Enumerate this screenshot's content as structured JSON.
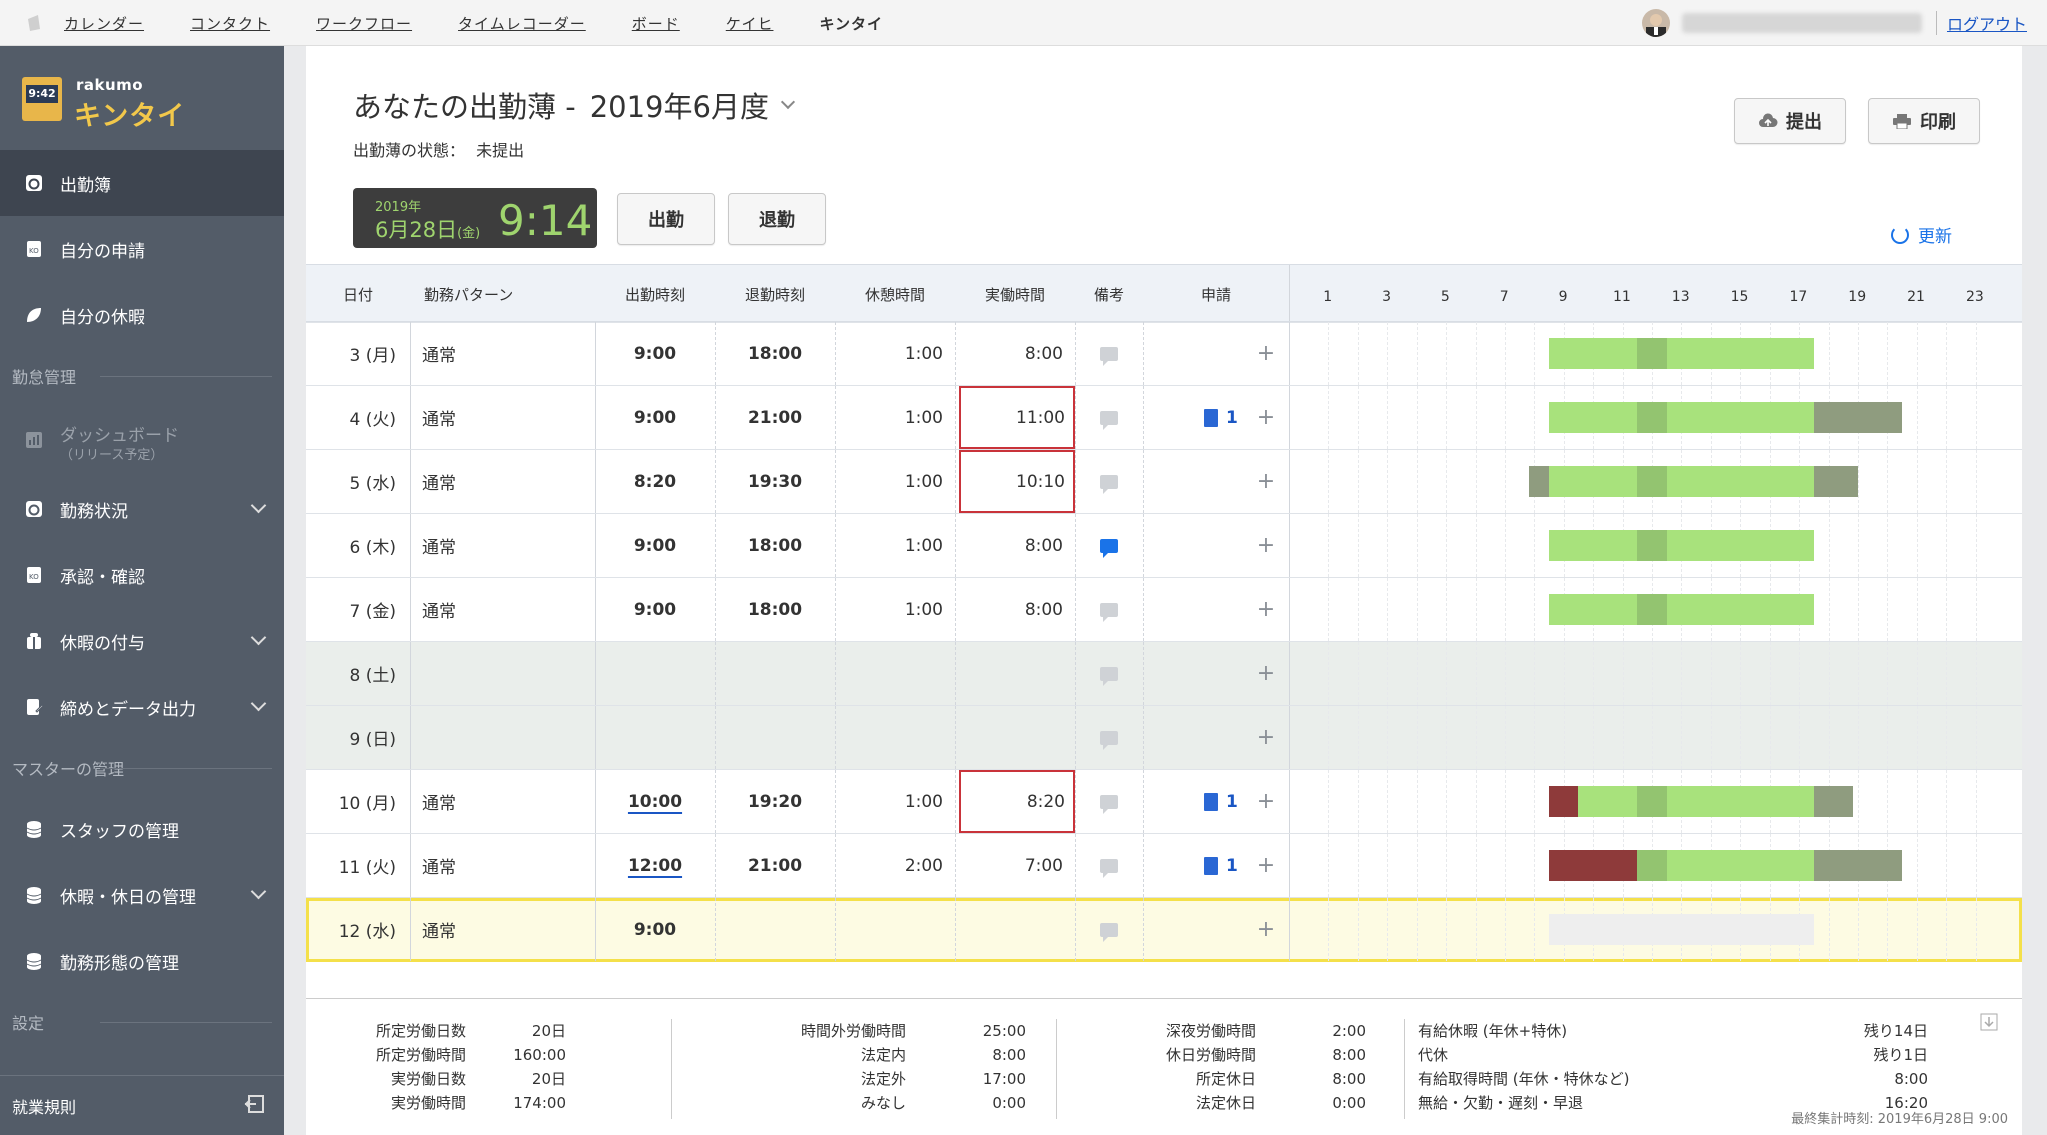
{
  "topnav": {
    "items": [
      "カレンダー",
      "コンタクト",
      "ワークフロー",
      "タイムレコーダー",
      "ボード",
      "ケイヒ",
      "キンタイ"
    ],
    "logout": "ログアウト"
  },
  "brand": {
    "name": "rakumo",
    "product": "キンタイ",
    "clock_face": "9:42"
  },
  "sidebar": {
    "items": [
      {
        "label": "出勤簿"
      },
      {
        "label": "自分の申請"
      },
      {
        "label": "自分の休暇"
      }
    ],
    "section1": "勤怠管理",
    "mgmt": [
      {
        "label": "ダッシュボード",
        "sub": "（リリース予定）"
      },
      {
        "label": "勤務状況"
      },
      {
        "label": "承認・確認"
      },
      {
        "label": "休暇の付与"
      },
      {
        "label": "締めとデータ出力"
      }
    ],
    "section2": "マスターの管理",
    "master": [
      {
        "label": "スタッフの管理"
      },
      {
        "label": "休暇・休日の管理"
      },
      {
        "label": "勤務形態の管理"
      }
    ],
    "section3": "設定",
    "bottom": "就業規則"
  },
  "header": {
    "title": "あなたの出勤薄 -",
    "period": "2019年6月度",
    "status_label": "出勤薄の状態：",
    "status_value": "未提出",
    "submit": "提出",
    "print": "印刷",
    "refresh": "更新"
  },
  "clock": {
    "year": "2019年",
    "date": "6月28日",
    "dow": "(金)",
    "time": "9:14"
  },
  "actions": {
    "clock_in": "出勤",
    "clock_out": "退勤"
  },
  "columns": [
    "日付",
    "勤務パターン",
    "出勤時刻",
    "退勤時刻",
    "休憩時間",
    "実働時間",
    "備考",
    "申請"
  ],
  "hours": [
    "1",
    "3",
    "5",
    "7",
    "9",
    "11",
    "13",
    "15",
    "17",
    "19",
    "21",
    "23"
  ],
  "rows": [
    {
      "date": "3 (月)",
      "pattern": "通常",
      "in": "9:00",
      "out": "18:00",
      "break": "1:00",
      "work": "8:00",
      "req": ""
    },
    {
      "date": "4 (火)",
      "pattern": "通常",
      "in": "9:00",
      "out": "21:00",
      "break": "1:00",
      "work": "11:00",
      "req": "1"
    },
    {
      "date": "5 (水)",
      "pattern": "通常",
      "in": "8:20",
      "out": "19:30",
      "break": "1:00",
      "work": "10:10",
      "req": ""
    },
    {
      "date": "6 (木)",
      "pattern": "通常",
      "in": "9:00",
      "out": "18:00",
      "break": "1:00",
      "work": "8:00",
      "req": ""
    },
    {
      "date": "7 (金)",
      "pattern": "通常",
      "in": "9:00",
      "out": "18:00",
      "break": "1:00",
      "work": "8:00",
      "req": ""
    },
    {
      "date": "8 (土)",
      "pattern": "",
      "in": "",
      "out": "",
      "break": "",
      "work": "",
      "req": ""
    },
    {
      "date": "9 (日)",
      "pattern": "",
      "in": "",
      "out": "",
      "break": "",
      "work": "",
      "req": ""
    },
    {
      "date": "10 (月)",
      "pattern": "通常",
      "in": "10:00",
      "out": "19:20",
      "break": "1:00",
      "work": "8:20",
      "req": "1"
    },
    {
      "date": "11 (火)",
      "pattern": "通常",
      "in": "12:00",
      "out": "21:00",
      "break": "2:00",
      "work": "7:00",
      "req": "1"
    },
    {
      "date": "12 (水)",
      "pattern": "通常",
      "in": "9:00",
      "out": "",
      "break": "",
      "work": "",
      "req": ""
    }
  ],
  "summary": {
    "col1": [
      [
        "所定労働日数",
        "20日"
      ],
      [
        "所定労働時間",
        "160:00"
      ],
      [
        "実労働日数",
        "20日"
      ],
      [
        "実労働時間",
        "174:00"
      ]
    ],
    "col2": [
      [
        "時間外労働時間",
        "25:00"
      ],
      [
        "法定内",
        "8:00"
      ],
      [
        "法定外",
        "17:00"
      ],
      [
        "みなし",
        "0:00"
      ]
    ],
    "col3": [
      [
        "深夜労働時間",
        "2:00"
      ],
      [
        "休日労働時間",
        "8:00"
      ],
      [
        "所定休日",
        "8:00"
      ],
      [
        "法定休日",
        "0:00"
      ]
    ],
    "col4": [
      [
        "有給休暇 (年休+特休)",
        "残り14日"
      ],
      [
        "代休",
        "残り1日"
      ],
      [
        "有給取得時間 (年休・特休など)",
        "8:00"
      ],
      [
        "無給・欠勤・遅刻・早退",
        "16:20"
      ]
    ],
    "last": "最終集計時刻: 2019年6月28日 9:00"
  },
  "colors": {
    "normal": "#a8e27c",
    "break": "#93c470",
    "overtime": "#8f9c7f",
    "late": "#8e3a3a",
    "pending": "#eeeeee",
    "sidebar": "#535c68",
    "accent": "#1a73e8"
  }
}
